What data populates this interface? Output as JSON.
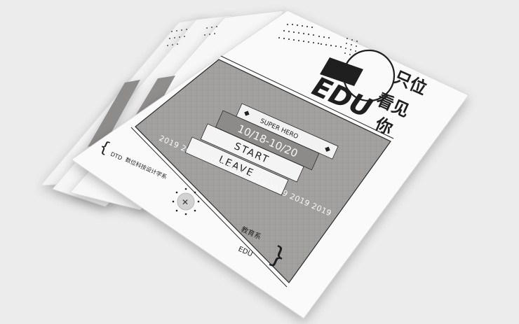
{
  "poster": {
    "title_line1": "只位",
    "title_line2": "看见",
    "title_line3": "你",
    "logo_text": "EDU",
    "tag": "SUPER HERO",
    "dates": "10/18-10/20",
    "start_label": "START",
    "leave_label": "LEAVE",
    "year_band": "2019 2019 2019 2019 2019 2019 2019 2019",
    "dtd_label": "DTD",
    "dept_cn": "数位科技设计学系",
    "school_cn": "教育系",
    "edu_label": "EDU",
    "seal_glyph": "✕"
  },
  "colors": {
    "background": "#ececec",
    "paper": "#fafafa",
    "panel": "#9d9b99",
    "ink": "#1f1f1f"
  }
}
